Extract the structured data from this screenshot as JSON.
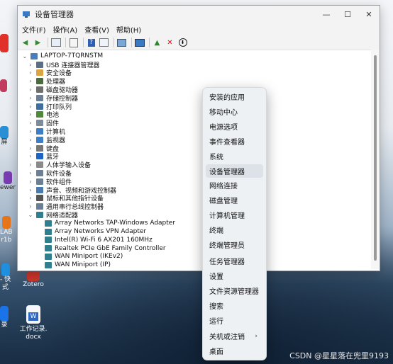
{
  "window": {
    "title": "设备管理器",
    "menu": [
      "文件(F)",
      "操作(A)",
      "查看(V)",
      "帮助(H)"
    ]
  },
  "tree": {
    "root": "LAPTOP-7TQRNSTM",
    "categories": [
      {
        "label": "USB 连接器管理器",
        "icon": "usb-icon"
      },
      {
        "label": "安全设备",
        "icon": "security-device-icon"
      },
      {
        "label": "处理器",
        "icon": "processor-icon"
      },
      {
        "label": "磁盘驱动器",
        "icon": "disk-drive-icon"
      },
      {
        "label": "存储控制器",
        "icon": "storage-controller-icon"
      },
      {
        "label": "打印队列",
        "icon": "printer-icon"
      },
      {
        "label": "电池",
        "icon": "battery-icon"
      },
      {
        "label": "固件",
        "icon": "firmware-icon"
      },
      {
        "label": "计算机",
        "icon": "computer-icon"
      },
      {
        "label": "监视器",
        "icon": "monitor-icon"
      },
      {
        "label": "键盘",
        "icon": "keyboard-icon"
      },
      {
        "label": "蓝牙",
        "icon": "bluetooth-icon"
      },
      {
        "label": "人体学输入设备",
        "icon": "hid-icon"
      },
      {
        "label": "软件设备",
        "icon": "software-device-icon"
      },
      {
        "label": "软件组件",
        "icon": "software-component-icon"
      },
      {
        "label": "声音、视频和游戏控制器",
        "icon": "sound-icon"
      },
      {
        "label": "鼠标和其他指针设备",
        "icon": "mouse-icon"
      },
      {
        "label": "通用串行总线控制器",
        "icon": "usb-controller-icon"
      },
      {
        "label": "网络适配器",
        "icon": "network-adapter-icon"
      }
    ],
    "network_adapters": [
      "Array Networks TAP-Windows Adapter",
      "Array Networks VPN Adapter",
      "Intel(R) Wi-Fi 6 AX201 160MHz",
      "Realtek PCIe GbE Family Controller",
      "WAN Miniport (IKEv2)",
      "WAN Miniport (IP)"
    ]
  },
  "context_menu": {
    "items": [
      "安装的应用",
      "移动中心",
      "电源选项",
      "事件查看器",
      "系统",
      "设备管理器",
      "网络连接",
      "磁盘管理",
      "计算机管理",
      "终端",
      "终端管理员",
      "任务管理器",
      "设置",
      "文件资源管理器",
      "搜索",
      "运行",
      "关机或注销",
      "桌面"
    ],
    "highlighted": "设备管理器",
    "submenu_item": "关机或注销"
  },
  "desktop": {
    "icons": [
      {
        "label": "Zotero",
        "icon": "zotero-icon"
      },
      {
        "label": "工作记录.\ndocx",
        "icon": "word-doc-icon"
      }
    ],
    "partial_labels": [
      "屏",
      "ewer",
      "LAB",
      "r1b",
      "- 快",
      "式",
      "录"
    ]
  },
  "watermark": "CSDN @星星落在兜里9193",
  "colors": {
    "accent": "#0067c0",
    "menu_bg": "#eef1f4",
    "highlight": "#dde2e8"
  }
}
